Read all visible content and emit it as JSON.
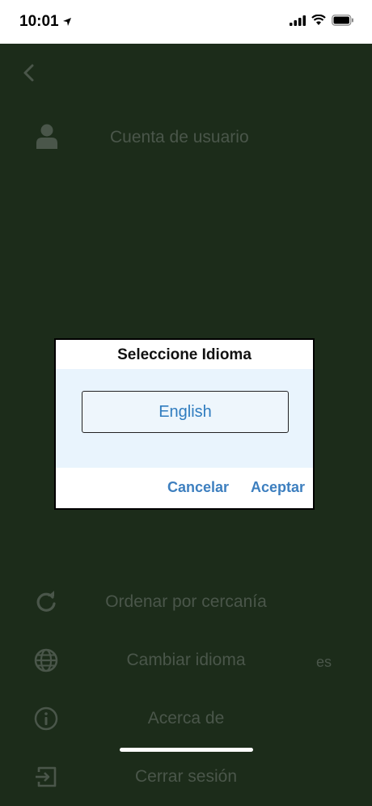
{
  "status_bar": {
    "time": "10:01"
  },
  "account": {
    "label": "Cuenta de usuario"
  },
  "menu": {
    "items": [
      {
        "label": "Ordenar por cercanía",
        "icon": "refresh-icon"
      },
      {
        "label": "Cambiar idioma",
        "icon": "globe-icon",
        "value": "es"
      },
      {
        "label": "Acerca de",
        "icon": "info-icon"
      },
      {
        "label": "Cerrar sesión",
        "icon": "logout-icon"
      }
    ]
  },
  "dialog": {
    "title": "Seleccione Idioma",
    "selected_language": "English",
    "cancel_label": "Cancelar",
    "accept_label": "Aceptar"
  },
  "colors": {
    "background": "#1c2c1a",
    "muted_text": "#4a564a",
    "accent": "#3d7fbf",
    "dialog_body": "#e9f4fd"
  }
}
